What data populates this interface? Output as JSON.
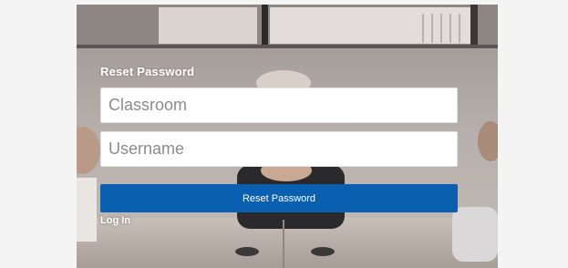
{
  "form": {
    "title": "Reset Password",
    "classroom_placeholder": "Classroom",
    "username_placeholder": "Username",
    "reset_button_label": "Reset Password",
    "login_link_label": "Log In"
  },
  "colors": {
    "button": "#0a5fb1",
    "page_background": "#f4f4f4",
    "text_on_background": "#ffffff"
  }
}
